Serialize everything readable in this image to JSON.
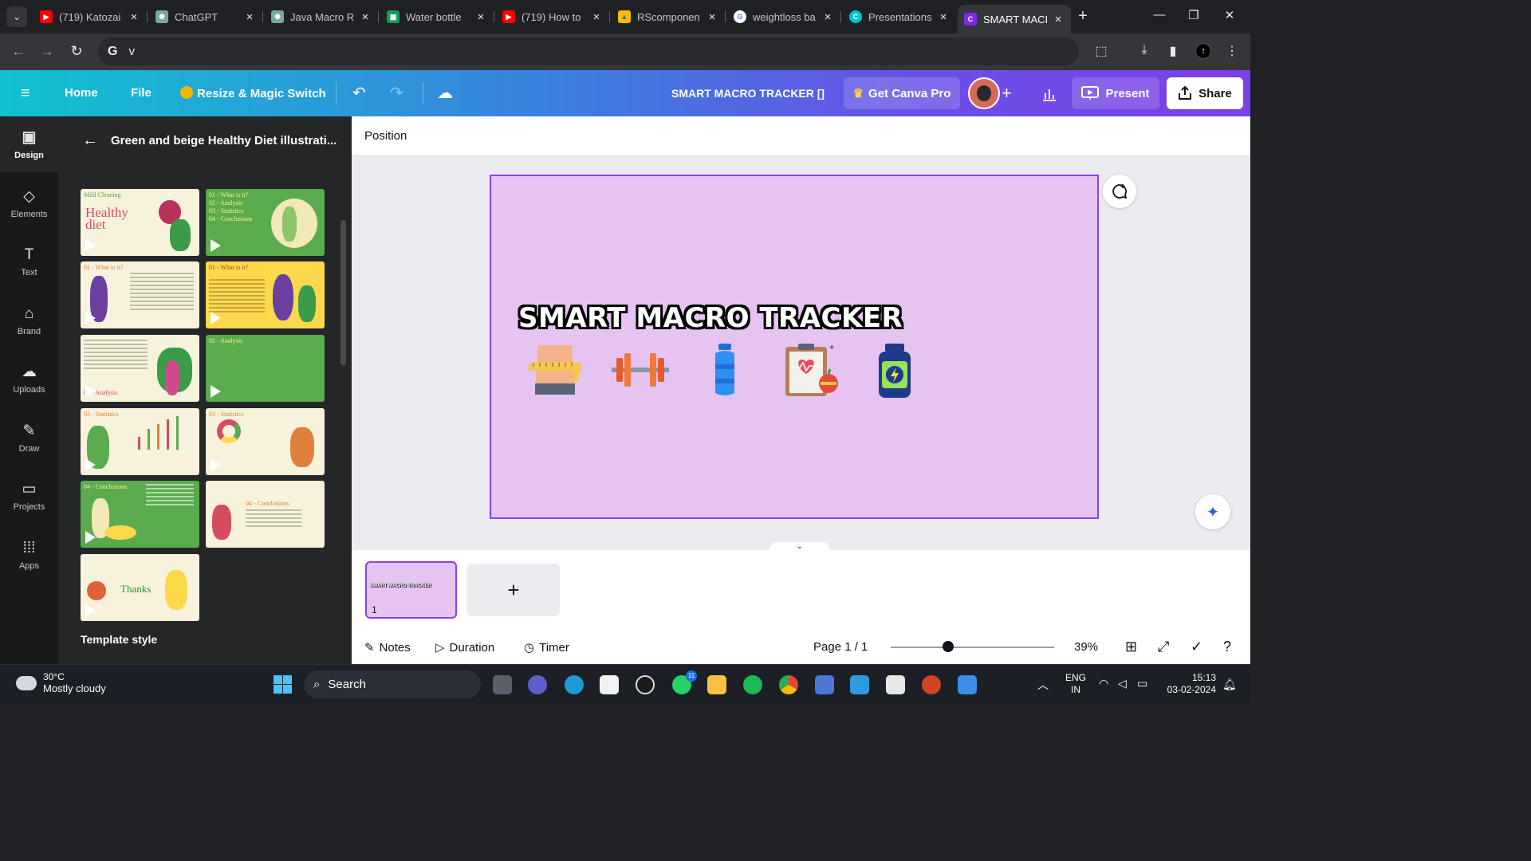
{
  "browser": {
    "tabs": [
      {
        "title": "(719) Katozai",
        "favicon": "youtube-icon",
        "color": "#ff0000"
      },
      {
        "title": "ChatGPT",
        "favicon": "chatgpt-icon",
        "color": "#74aa9c"
      },
      {
        "title": "Java Macro R",
        "favicon": "chatgpt-icon",
        "color": "#74aa9c"
      },
      {
        "title": "Water bottle",
        "favicon": "sheets-icon",
        "color": "#0f9d58"
      },
      {
        "title": "(719) How to",
        "favicon": "youtube-icon",
        "color": "#ff0000"
      },
      {
        "title": "RScomponen",
        "favicon": "drive-icon",
        "color": "#fbbc04"
      },
      {
        "title": "weightloss ba",
        "favicon": "google-icon",
        "color": "#4285f4"
      },
      {
        "title": "Presentations",
        "favicon": "canva-icon",
        "color": "#00c4cc"
      },
      {
        "title": "SMART MACI",
        "favicon": "canva-icon",
        "color": "#7d2ae8",
        "active": true
      }
    ],
    "address": "v"
  },
  "header": {
    "home": "Home",
    "file": "File",
    "resize": "Resize & Magic Switch",
    "doc_title": "SMART MACRO TRACKER []",
    "get_pro": "Get Canva Pro",
    "present": "Present",
    "share": "Share"
  },
  "rail": [
    {
      "label": "Design",
      "icon": "design-icon"
    },
    {
      "label": "Elements",
      "icon": "elements-icon"
    },
    {
      "label": "Text",
      "icon": "text-icon"
    },
    {
      "label": "Brand",
      "icon": "brand-icon"
    },
    {
      "label": "Uploads",
      "icon": "uploads-icon"
    },
    {
      "label": "Draw",
      "icon": "draw-icon"
    },
    {
      "label": "Projects",
      "icon": "projects-icon"
    },
    {
      "label": "Apps",
      "icon": "apps-icon"
    }
  ],
  "panel": {
    "title": "Green and beige Healthy Diet illustrati...",
    "template_style": "Template style",
    "thumbs": [
      {
        "kicker": "Mild Cleaning",
        "big": "Healthy diet"
      },
      {
        "kicker": "01 - What is it?\n02 - Analysis\n03 - Statistics\n04 - Conclusions"
      },
      {
        "kicker": "01 - What is it?"
      },
      {
        "kicker": "01 - What is it?"
      },
      {
        "kicker": "02 - Analysis"
      },
      {
        "kicker": "02 - Analysis"
      },
      {
        "kicker": "03 - Statistics"
      },
      {
        "kicker": "03 - Statistics"
      },
      {
        "kicker": "04 - Conclusions"
      },
      {
        "kicker": "04 - Conclusions"
      },
      {
        "kicker": "",
        "mid": "Thanks"
      }
    ]
  },
  "editor": {
    "position_label": "Position",
    "slide_title": "SMART MACRO TRACKER",
    "slide_icons": [
      "waist-measure-icon",
      "dumbbell-icon",
      "water-bottle-icon",
      "health-clipboard-icon",
      "supplement-jar-icon"
    ],
    "page_number": "1",
    "mini_title": "SMART MACRO TRACKER",
    "colors": {
      "slide_bg": "#e5c4f2",
      "selection": "#8b3dff"
    }
  },
  "footer": {
    "notes": "Notes",
    "duration": "Duration",
    "timer": "Timer",
    "page_indicator": "Page 1 / 1",
    "zoom": "39%"
  },
  "taskbar": {
    "temp": "30°C",
    "weather": "Mostly cloudy",
    "search": "Search",
    "whatsapp_badge": "11",
    "lang_top": "ENG",
    "lang_bottom": "IN",
    "time": "15:13",
    "date": "03-02-2024"
  }
}
